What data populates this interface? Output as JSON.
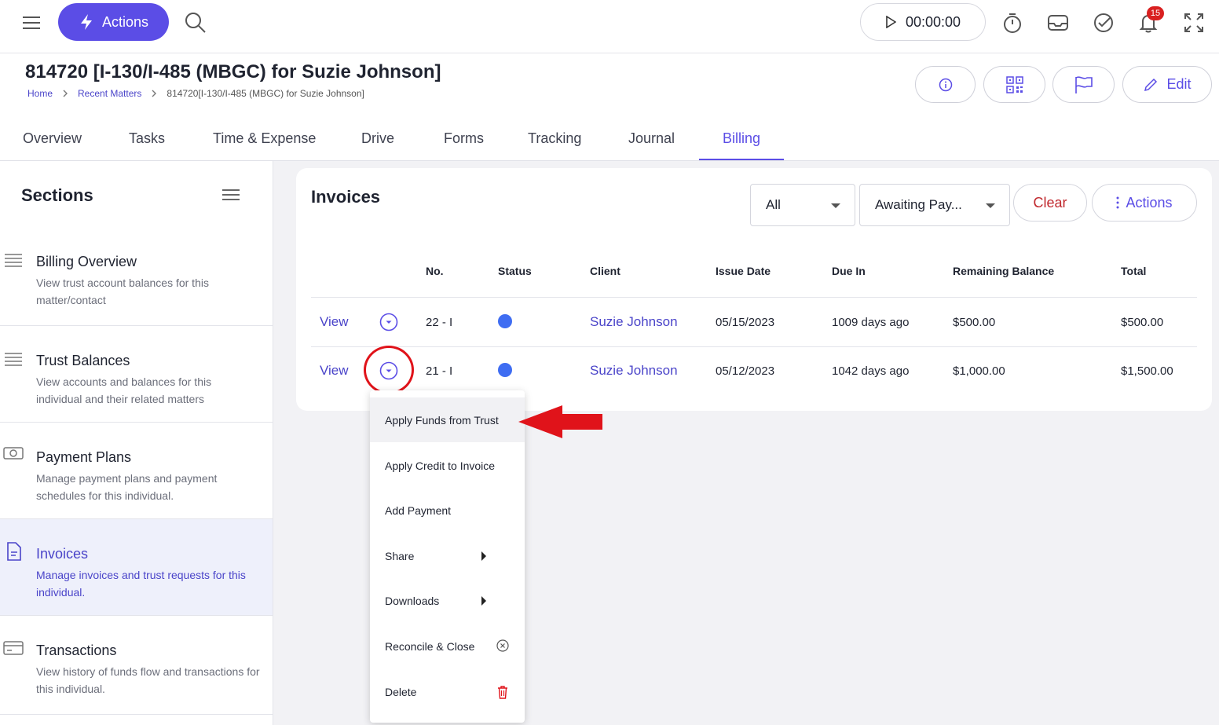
{
  "topbar": {
    "actions_label": "Actions",
    "timer": "00:00:00",
    "notification_count": "15"
  },
  "header": {
    "title": "814720 [I-130/I-485 (MBGC) for Suzie Johnson]",
    "breadcrumb": [
      "Home",
      "Recent Matters",
      "814720[I-130/I-485 (MBGC) for Suzie Johnson]"
    ],
    "edit_label": "Edit"
  },
  "tabs": [
    {
      "label": "Overview"
    },
    {
      "label": "Tasks"
    },
    {
      "label": "Time & Expense"
    },
    {
      "label": "Drive"
    },
    {
      "label": "Forms"
    },
    {
      "label": "Tracking"
    },
    {
      "label": "Journal"
    },
    {
      "label": "Billing",
      "active": true
    }
  ],
  "sidebar": {
    "title": "Sections",
    "items": [
      {
        "title": "Billing Overview",
        "desc": "View trust account balances for this matter/contact"
      },
      {
        "title": "Trust Balances",
        "desc": "View accounts and balances for this individual and their related matters"
      },
      {
        "title": "Payment Plans",
        "desc": "Manage payment plans and payment schedules for this individual."
      },
      {
        "title": "Invoices",
        "desc": "Manage invoices and trust requests for this individual.",
        "active": true
      },
      {
        "title": "Transactions",
        "desc": "View history of funds flow and transactions for this individual."
      }
    ]
  },
  "invoices": {
    "title": "Invoices",
    "filter_type": "All",
    "filter_status": "Awaiting Pay...",
    "clear_label": "Clear",
    "actions_label": "Actions",
    "columns": [
      "No.",
      "Status",
      "Client",
      "Issue Date",
      "Due In",
      "Remaining Balance",
      "Total"
    ],
    "rows": [
      {
        "view": "View",
        "no": "22 - I",
        "client": "Suzie Johnson",
        "issue_date": "05/15/2023",
        "due_in": "1009 days ago",
        "remaining": "$500.00",
        "total": "$500.00"
      },
      {
        "view": "View",
        "no": "21 - I",
        "client": "Suzie Johnson",
        "issue_date": "05/12/2023",
        "due_in": "1042 days ago",
        "remaining": "$1,000.00",
        "total": "$1,500.00"
      }
    ]
  },
  "row_menu": {
    "items": [
      "Apply Funds from Trust",
      "Apply Credit to Invoice",
      "Add Payment",
      "Share",
      "Downloads",
      "Reconcile & Close",
      "Delete"
    ]
  },
  "colors": {
    "accent": "#5b4de6",
    "annotation": "#e0131a",
    "status_dot": "#3f6df2",
    "danger": "#c0282d"
  },
  "icons": [
    "menu-icon",
    "bolt-icon",
    "search-icon",
    "play-icon",
    "stopwatch-icon",
    "inbox-icon",
    "check-circle-icon",
    "bell-icon",
    "fullscreen-icon",
    "info-icon",
    "qr-code-icon",
    "flag-icon",
    "pencil-icon",
    "kebab-icon",
    "chevron-down-circle-icon",
    "triangle-right-icon",
    "close-circle-icon",
    "trash-icon"
  ]
}
